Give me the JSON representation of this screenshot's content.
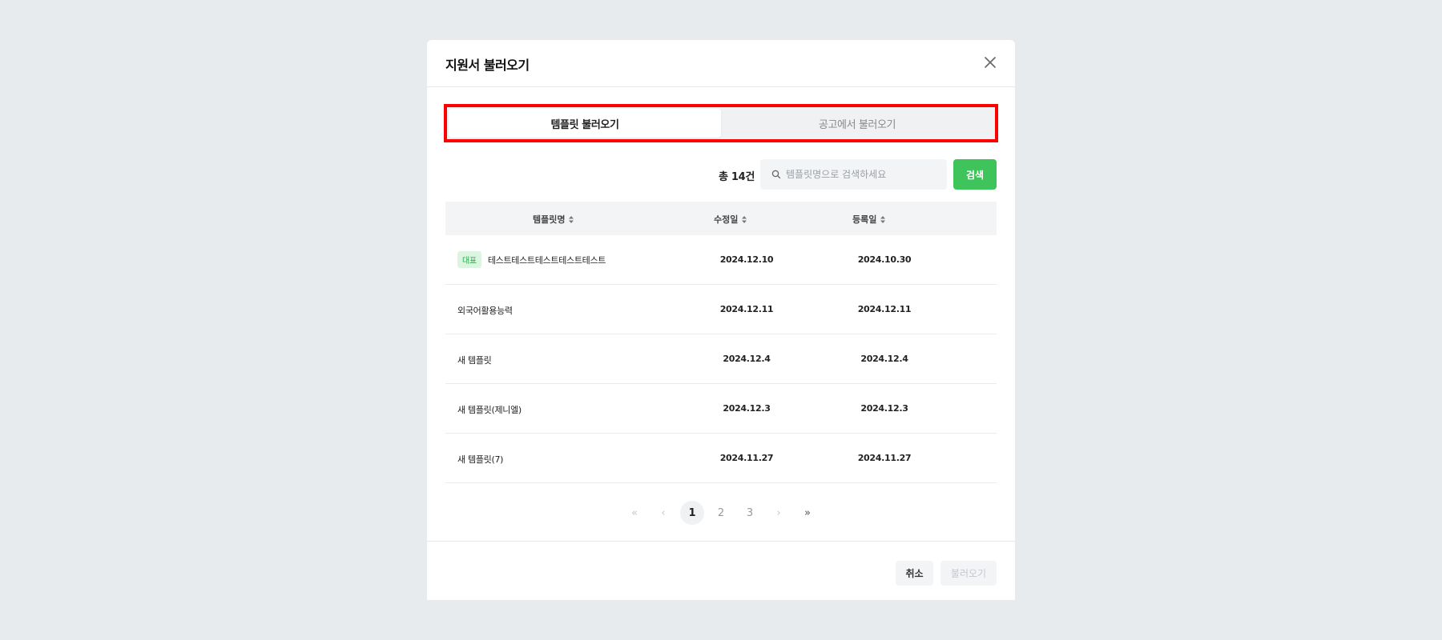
{
  "modal": {
    "title": "지원서 불러오기"
  },
  "tabs": [
    {
      "label": "템플릿 불러오기",
      "active": true
    },
    {
      "label": "공고에서 불러오기",
      "active": false
    }
  ],
  "toolbar": {
    "total": "총 14건",
    "search_placeholder": "템플릿명으로 검색하세요",
    "search_button": "검색"
  },
  "table": {
    "columns": [
      "템플릿명",
      "수정일",
      "등록일"
    ],
    "rows": [
      {
        "badge": "대표",
        "name": "테스트테스트테스트테스트테스트",
        "modified": "2024.12.10",
        "registered": "2024.10.30"
      },
      {
        "badge": "",
        "name": "외국어활용능력",
        "modified": "2024.12.11",
        "registered": "2024.12.11"
      },
      {
        "badge": "",
        "name": "새 템플릿",
        "modified": "2024.12.4",
        "registered": "2024.12.4"
      },
      {
        "badge": "",
        "name": "새 템플릿(제니엘)",
        "modified": "2024.12.3",
        "registered": "2024.12.3"
      },
      {
        "badge": "",
        "name": "새 템플릿(7)",
        "modified": "2024.11.27",
        "registered": "2024.11.27"
      }
    ]
  },
  "pagination": {
    "first": "«",
    "prev": "‹",
    "pages": [
      "1",
      "2",
      "3"
    ],
    "current": "1",
    "next": "›",
    "last": "»"
  },
  "footer": {
    "cancel": "취소",
    "load": "불러오기"
  },
  "colors": {
    "accent": "#3fc35b",
    "highlight_border": "#ff0000",
    "badge_bg": "#dcf5e1",
    "badge_text": "#2fa84a"
  }
}
